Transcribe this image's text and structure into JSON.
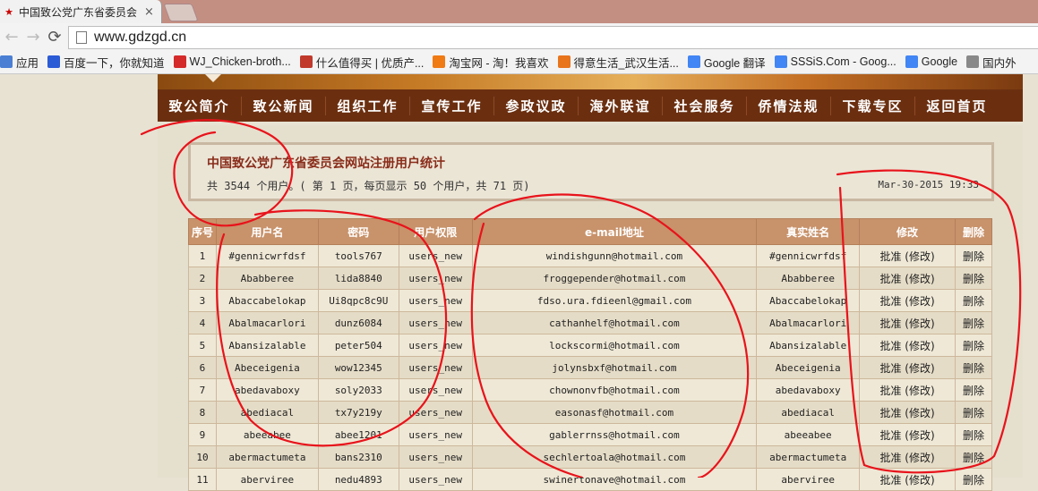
{
  "browser": {
    "tab_title": "中国致公党广东省委员会",
    "tab_close": "×",
    "url": "www.gdzgd.cn",
    "bookmarks": [
      {
        "label": "应用",
        "icon": "apps-icon",
        "color": "#4a7fd4"
      },
      {
        "label": "百度一下，你就知道",
        "icon": "baidu-icon",
        "color": "#2c5bd6"
      },
      {
        "label": "WJ_Chicken-broth...",
        "icon": "weibo-icon",
        "color": "#d52a2a"
      },
      {
        "label": "什么值得买 | 优质产...",
        "icon": "smzdm-icon",
        "color": "#c0392b"
      },
      {
        "label": "淘宝网 - 淘！我喜欢",
        "icon": "taobao-icon",
        "color": "#f07a14"
      },
      {
        "label": "得意生活_武汉生活...",
        "icon": "deyi-icon",
        "color": "#e8741c"
      },
      {
        "label": "Google 翻译",
        "icon": "google-translate-icon",
        "color": "#4285f4"
      },
      {
        "label": "SSSiS.Com - Goog...",
        "icon": "google-icon",
        "color": "#4285f4"
      },
      {
        "label": "Google",
        "icon": "google-icon",
        "color": "#4285f4"
      },
      {
        "label": "国内外",
        "icon": "page-icon",
        "color": "#888888"
      }
    ]
  },
  "nav": [
    "致公简介",
    "致公新闻",
    "组织工作",
    "宣传工作",
    "参政议政",
    "海外联谊",
    "社会服务",
    "侨情法规",
    "下载专区",
    "返回首页"
  ],
  "stats": {
    "title": "中国致公党广东省委员会网站注册用户统计",
    "summary": "共 3544 个用户。( 第 1 页，每页显示 50 个用户，共 71 页)",
    "date": "Mar-30-2015 19:33"
  },
  "table": {
    "headers": [
      "序号",
      "用户名",
      "密码",
      "用户权限",
      "e-mail地址",
      "真实姓名",
      "修改",
      "删除"
    ],
    "edit_label": "批准 (修改)",
    "delete_label": "删除",
    "rows": [
      {
        "no": "1",
        "username": "#gennicwrfdsf",
        "password": "tools767",
        "role": "users_new",
        "email": "windishgunn@hotmail.com",
        "realname": "#gennicwrfdsf"
      },
      {
        "no": "2",
        "username": "Ababberee",
        "password": "lida8840",
        "role": "users_new",
        "email": "froggepender@hotmail.com",
        "realname": "Ababberee"
      },
      {
        "no": "3",
        "username": "Abaccabelokap",
        "password": "Ui8qpc8c9U",
        "role": "users_new",
        "email": "fdso.ura.fdieenl@gmail.com",
        "realname": "Abaccabelokap"
      },
      {
        "no": "4",
        "username": "Abalmacarlori",
        "password": "dunz6084",
        "role": "users_new",
        "email": "cathanhelf@hotmail.com",
        "realname": "Abalmacarlori"
      },
      {
        "no": "5",
        "username": "Abansizalable",
        "password": "peter504",
        "role": "users_new",
        "email": "lockscormi@hotmail.com",
        "realname": "Abansizalable"
      },
      {
        "no": "6",
        "username": "Abeceigenia",
        "password": "wow12345",
        "role": "users_new",
        "email": "jolynsbxf@hotmail.com",
        "realname": "Abeceigenia"
      },
      {
        "no": "7",
        "username": "abedavaboxy",
        "password": "soly2033",
        "role": "users_new",
        "email": "chownonvfb@hotmail.com",
        "realname": "abedavaboxy"
      },
      {
        "no": "8",
        "username": "abediacal",
        "password": "tx7y219y",
        "role": "users_new",
        "email": "easonasf@hotmail.com",
        "realname": "abediacal"
      },
      {
        "no": "9",
        "username": "abeeabee",
        "password": "abee1201",
        "role": "users_new",
        "email": "gablerrnss@hotmail.com",
        "realname": "abeeabee"
      },
      {
        "no": "10",
        "username": "abermactumeta",
        "password": "bans2310",
        "role": "users_new",
        "email": "sechlertoala@hotmail.com",
        "realname": "abermactumeta"
      },
      {
        "no": "11",
        "username": "aberviree",
        "password": "nedu4893",
        "role": "users_new",
        "email": "swinertonave@hotmail.com",
        "realname": "aberviree"
      }
    ]
  },
  "annotation_color": "#e8131b"
}
